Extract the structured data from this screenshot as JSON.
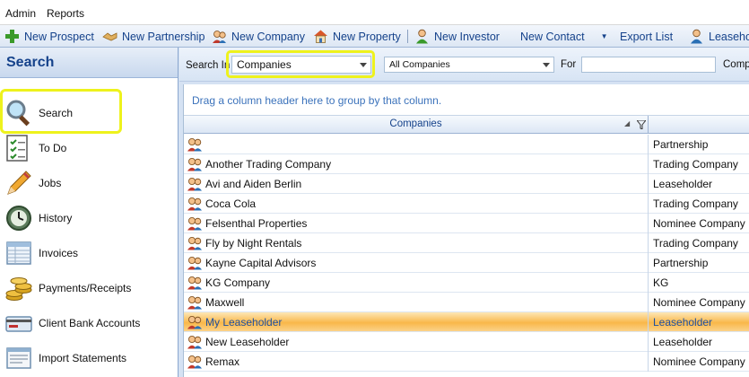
{
  "menu": {
    "items": [
      "Admin",
      "Reports"
    ]
  },
  "toolbar": {
    "items": [
      {
        "label": "New Prospect",
        "icon": "plus-icon"
      },
      {
        "label": "New Partnership",
        "icon": "handshake-icon"
      },
      {
        "label": "New Company",
        "icon": "people-icon"
      },
      {
        "label": "New Property",
        "icon": "house-icon"
      },
      {
        "label": "New Investor",
        "icon": "person-icon"
      },
      {
        "label": "New Contact",
        "icon": ""
      },
      {
        "label": "Export List",
        "icon": ""
      },
      {
        "label": "Leaseho",
        "icon": "person-icon"
      }
    ]
  },
  "sidebar": {
    "title": "Search",
    "items": [
      {
        "label": "Search",
        "icon": "magnifier-icon"
      },
      {
        "label": "To Do",
        "icon": "checklist-icon"
      },
      {
        "label": "Jobs",
        "icon": "pencil-icon"
      },
      {
        "label": "History",
        "icon": "clock-icon"
      },
      {
        "label": "Invoices",
        "icon": "ledger-icon"
      },
      {
        "label": "Payments/Receipts",
        "icon": "coins-icon"
      },
      {
        "label": "Client Bank Accounts",
        "icon": "bank-card-icon"
      },
      {
        "label": "Import Statements",
        "icon": "statement-icon"
      }
    ]
  },
  "searchbar": {
    "search_in_label": "Search In",
    "search_in_value": "Companies",
    "scope_value": "All Companies",
    "for_label": "For",
    "for_value": "",
    "trailing_label": "Comp"
  },
  "grid": {
    "group_hint": "Drag a column header here to group by that column.",
    "column_header": "Companies",
    "rows": [
      {
        "name": "",
        "type": "Partnership"
      },
      {
        "name": "Another Trading Company",
        "type": "Trading Company"
      },
      {
        "name": "Avi and Aiden Berlin",
        "type": "Leaseholder"
      },
      {
        "name": "Coca Cola",
        "type": "Trading Company"
      },
      {
        "name": "Felsenthal Properties",
        "type": "Nominee Company"
      },
      {
        "name": "Fly by Night Rentals",
        "type": "Trading Company"
      },
      {
        "name": "Kayne Capital Advisors",
        "type": "Partnership"
      },
      {
        "name": "KG Company",
        "type": "KG"
      },
      {
        "name": "Maxwell",
        "type": "Nominee Company"
      },
      {
        "name": "My Leaseholder",
        "type": "Leaseholder"
      },
      {
        "name": "New Leaseholder",
        "type": "Leaseholder"
      },
      {
        "name": "Remax",
        "type": "Nominee Company"
      }
    ],
    "selected_index": 9
  },
  "colors": {
    "accent": "#15428b",
    "highlight": "#eef21d",
    "selection": "#f9b74a"
  }
}
